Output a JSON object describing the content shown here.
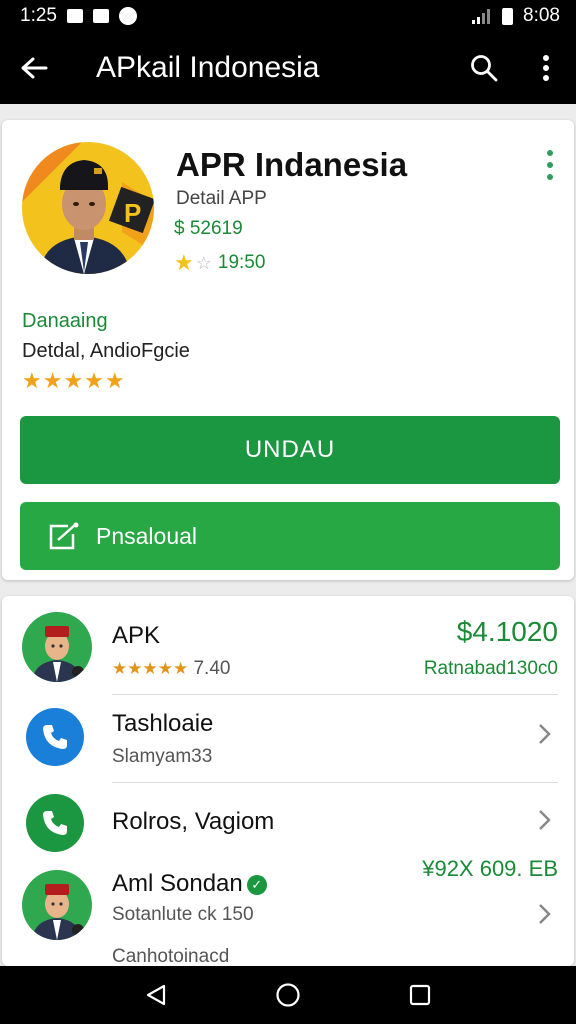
{
  "status_bar": {
    "time": "1:25",
    "battery_time": "8:08"
  },
  "app_bar": {
    "title": "APkail Indonesia"
  },
  "app_card": {
    "name": "APR Indanesia",
    "subtitle": "Detail APP",
    "price": "$ 52619",
    "rating_text": "19:50",
    "developer": "Danaaing",
    "description": "Detdal, AndioFgcie",
    "stars": "★★★★★",
    "primary_button": "UNDAU",
    "secondary_button": "Pnsaloual"
  },
  "list": {
    "rows": [
      {
        "title": "APK",
        "subtitle": "7.40",
        "stars": "★★★★★",
        "right_top": "$4.1020",
        "right_bottom": "Ratnabad130c0"
      },
      {
        "title": "Tashloaie",
        "subtitle": "Slamyam33"
      },
      {
        "title": "Rolros, Vagiom"
      },
      {
        "title": "Aml Sondan",
        "subtitle": "Sotanlute ck 150",
        "right_top": "¥92X 609. EB",
        "footer": "Canhotoinacd"
      }
    ]
  },
  "colors": {
    "accent": "#1a9740",
    "text_green": "#1a8a36",
    "star": "#f0a21a"
  },
  "icons": {
    "back": "arrow-left-icon",
    "search": "search-icon",
    "more": "more-vert-icon",
    "edit": "edit-square-icon",
    "phone": "phone-icon",
    "chevron": "chevron-right-icon"
  }
}
